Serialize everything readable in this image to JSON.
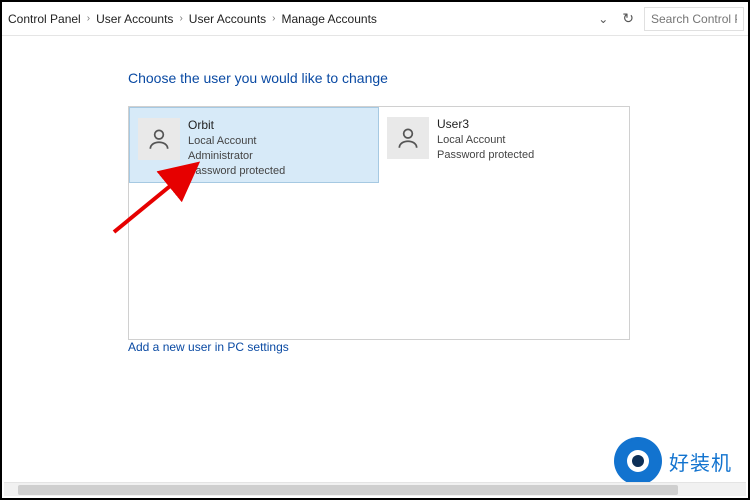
{
  "breadcrumbs": [
    "Control Panel",
    "User Accounts",
    "User Accounts",
    "Manage Accounts"
  ],
  "search": {
    "placeholder": "Search Control Panel"
  },
  "heading": "Choose the user you would like to change",
  "accounts": [
    {
      "name": "Orbit",
      "lines": [
        "Local Account",
        "Administrator",
        "Password protected"
      ],
      "selected": true
    },
    {
      "name": "User3",
      "lines": [
        "Local Account",
        "Password protected"
      ],
      "selected": false
    }
  ],
  "add_link": "Add a new user in PC settings",
  "watermark_text": "好装机"
}
